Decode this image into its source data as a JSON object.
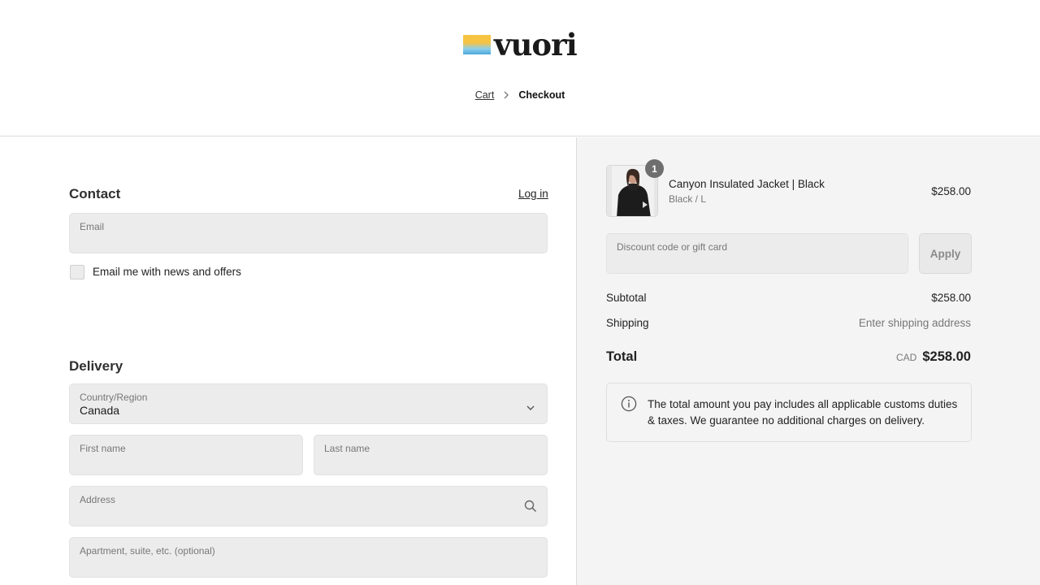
{
  "brand": {
    "logo_text": "vuori"
  },
  "breadcrumb": {
    "cart": "Cart",
    "current": "Checkout"
  },
  "contact": {
    "title": "Contact",
    "login_label": "Log in",
    "email_placeholder": "Email",
    "newsletter_label": "Email me with news and offers",
    "newsletter_checked": false
  },
  "delivery": {
    "title": "Delivery",
    "country_label": "Country/Region",
    "country_value": "Canada",
    "first_name_placeholder": "First name",
    "last_name_placeholder": "Last name",
    "address_placeholder": "Address",
    "apartment_placeholder": "Apartment, suite, etc. (optional)"
  },
  "summary": {
    "item": {
      "quantity": "1",
      "name": "Canyon Insulated Jacket | Black",
      "variant": "Black / L",
      "price": "$258.00"
    },
    "discount_placeholder": "Discount code or gift card",
    "apply_label": "Apply",
    "subtotal_label": "Subtotal",
    "subtotal_value": "$258.00",
    "shipping_label": "Shipping",
    "shipping_value": "Enter shipping address",
    "total_label": "Total",
    "total_currency": "CAD",
    "total_value": "$258.00",
    "notice": "The total amount you pay includes all applicable customs duties & taxes. We guarantee no additional charges on delivery."
  },
  "icons": {
    "breadcrumb_separator": "chevron-right-icon",
    "country_select": "chevron-down-icon",
    "address_search": "search-icon",
    "notice": "info-icon"
  }
}
